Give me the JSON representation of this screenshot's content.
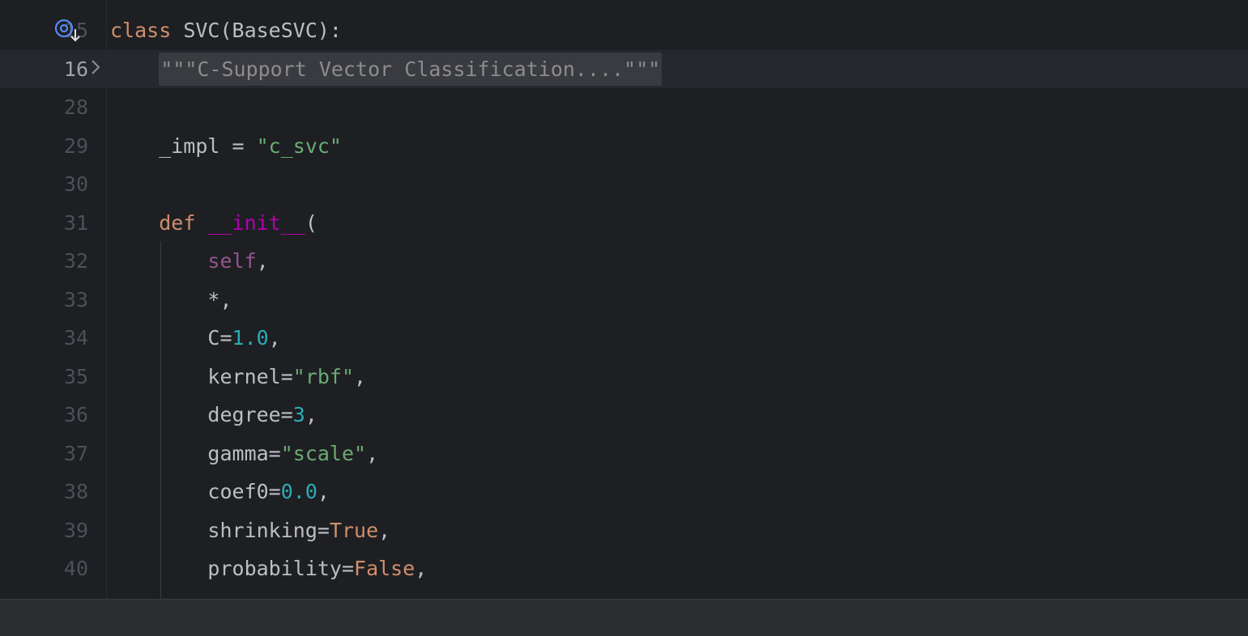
{
  "editor": {
    "gutter_icon": "override-method-icon",
    "fold_icon": "chevron-right-icon",
    "lines": [
      {
        "num": "15",
        "tokens": [
          [
            "class ",
            "kw"
          ],
          [
            "SVC(BaseSVC):",
            "plain"
          ]
        ]
      },
      {
        "num": "16",
        "current": true,
        "tokens": [
          [
            "    ",
            "plain"
          ],
          [
            "\"\"\"C-Support Vector Classification....\"\"\"",
            "fold"
          ]
        ]
      },
      {
        "num": "28",
        "tokens": []
      },
      {
        "num": "29",
        "tokens": [
          [
            "    _impl = ",
            "plain"
          ],
          [
            "\"c_svc\"",
            "str"
          ]
        ]
      },
      {
        "num": "30",
        "tokens": []
      },
      {
        "num": "31",
        "tokens": [
          [
            "    ",
            "plain"
          ],
          [
            "def ",
            "kw"
          ],
          [
            "__init__",
            "dunder"
          ],
          [
            "(",
            "plain"
          ]
        ]
      },
      {
        "num": "32",
        "tokens": [
          [
            "        ",
            "plain"
          ],
          [
            "self",
            "selfp"
          ],
          [
            ",",
            "plain"
          ]
        ]
      },
      {
        "num": "33",
        "tokens": [
          [
            "        *,",
            "plain"
          ]
        ]
      },
      {
        "num": "34",
        "tokens": [
          [
            "        C=",
            "plain"
          ],
          [
            "1.0",
            "num"
          ],
          [
            ",",
            "plain"
          ]
        ]
      },
      {
        "num": "35",
        "tokens": [
          [
            "        kernel=",
            "plain"
          ],
          [
            "\"rbf\"",
            "str"
          ],
          [
            ",",
            "plain"
          ]
        ]
      },
      {
        "num": "36",
        "tokens": [
          [
            "        degree=",
            "plain"
          ],
          [
            "3",
            "num"
          ],
          [
            ",",
            "plain"
          ]
        ]
      },
      {
        "num": "37",
        "tokens": [
          [
            "        gamma=",
            "plain"
          ],
          [
            "\"scale\"",
            "str"
          ],
          [
            ",",
            "plain"
          ]
        ]
      },
      {
        "num": "38",
        "tokens": [
          [
            "        coef0=",
            "plain"
          ],
          [
            "0.0",
            "num"
          ],
          [
            ",",
            "plain"
          ]
        ]
      },
      {
        "num": "39",
        "tokens": [
          [
            "        shrinking=",
            "plain"
          ],
          [
            "True",
            "kw"
          ],
          [
            ",",
            "plain"
          ]
        ]
      },
      {
        "num": "40",
        "tokens": [
          [
            "        probability=",
            "plain"
          ],
          [
            "False",
            "kw"
          ],
          [
            ",",
            "plain"
          ]
        ]
      }
    ]
  }
}
